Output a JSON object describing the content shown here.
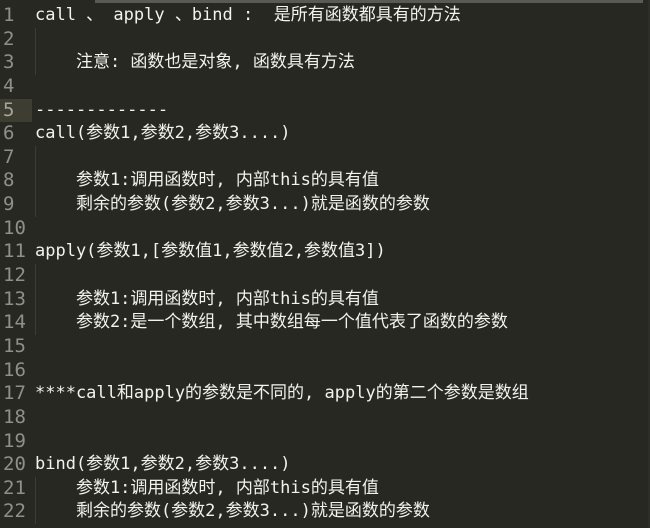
{
  "editor": {
    "active_line": 5,
    "lines": [
      {
        "num": "1",
        "text": "call 、 apply 、bind :  是所有函数都具有的方法"
      },
      {
        "num": "2",
        "text": ""
      },
      {
        "num": "3",
        "text": "    注意: 函数也是对象, 函数具有方法"
      },
      {
        "num": "4",
        "text": ""
      },
      {
        "num": "5",
        "text": "-------------"
      },
      {
        "num": "6",
        "text": "call(参数1,参数2,参数3....)"
      },
      {
        "num": "7",
        "text": ""
      },
      {
        "num": "8",
        "text": "    参数1:调用函数时, 内部this的具有值"
      },
      {
        "num": "9",
        "text": "    剩余的参数(参数2,参数3...)就是函数的参数"
      },
      {
        "num": "10",
        "text": ""
      },
      {
        "num": "11",
        "text": "apply(参数1,[参数值1,参数值2,参数值3])"
      },
      {
        "num": "12",
        "text": ""
      },
      {
        "num": "13",
        "text": "    参数1:调用函数时, 内部this的具有值"
      },
      {
        "num": "14",
        "text": "    参数2:是一个数组, 其中数组每一个值代表了函数的参数"
      },
      {
        "num": "15",
        "text": ""
      },
      {
        "num": "16",
        "text": ""
      },
      {
        "num": "17",
        "text": "****call和apply的参数是不同的, apply的第二个参数是数组"
      },
      {
        "num": "18",
        "text": ""
      },
      {
        "num": "19",
        "text": ""
      },
      {
        "num": "20",
        "text": "bind(参数1,参数2,参数3....)"
      },
      {
        "num": "21",
        "text": "    参数1:调用函数时, 内部this的具有值"
      },
      {
        "num": "22",
        "text": "    剩余的参数(参数2,参数3...)就是函数的参数"
      }
    ]
  }
}
